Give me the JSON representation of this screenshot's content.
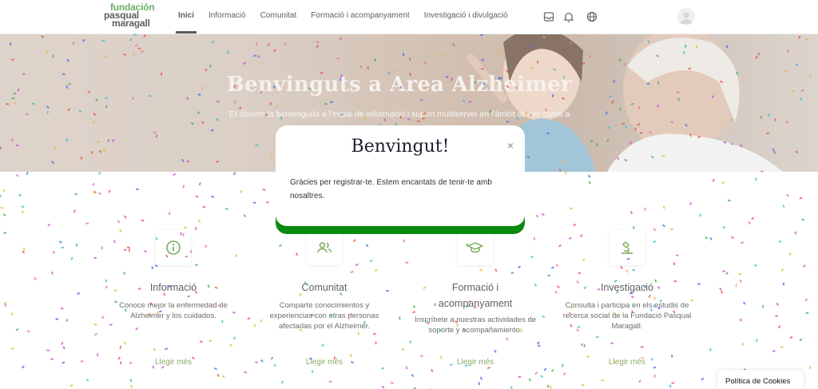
{
  "logo": {
    "line1": "fundación",
    "line2": "pasqual",
    "line3": "maragall"
  },
  "nav": [
    {
      "label": "Inici"
    },
    {
      "label": "Informació"
    },
    {
      "label": "Comunitat"
    },
    {
      "label": "Formació i acompanyament"
    },
    {
      "label": "Investigació i divulgació"
    }
  ],
  "header_icons": [
    "inbox-icon",
    "bell-icon",
    "globe-icon",
    "user-avatar-icon"
  ],
  "hero": {
    "title": "Benvinguts a Area Alzheimer",
    "subtitle": "Et donem la benvinguda a l'espai de informació i suport multiservei en l'àmbit de les cures a"
  },
  "sections": [
    {
      "icon": "info-icon",
      "title": "Informació",
      "desc": "Conoce mejor la enfermedad de Alzheimer y los cuidados.",
      "link": "Llegir més"
    },
    {
      "icon": "users-icon",
      "title": "Comunitat",
      "desc": "Comparte conocimientos y experiencias con otras personas afectadas por el Alzheimer.",
      "link": "Llegir més"
    },
    {
      "icon": "graduation-cap-icon",
      "title": "Formació i acompanyament",
      "desc": "Inscríbete a nuestras actividades de soporte y acompañamiento.",
      "link": "Llegir més"
    },
    {
      "icon": "microscope-icon",
      "title": "Investigació",
      "desc": "Consulta i participa en els estudis de recerca social de la Fundació Pasqual Maragall.",
      "link": "Llegir més"
    }
  ],
  "modal": {
    "title": "Benvingut!",
    "close": "×",
    "body": "Gràcies per registrar-te. Estem encantats de tenir-te amb nosaltres."
  },
  "cookie": {
    "label": "Política de Cookies"
  },
  "colors": {
    "brand_green": "#2f8f2a",
    "link_green": "#5c8a2a",
    "modal_accent": "#0a8a10"
  }
}
